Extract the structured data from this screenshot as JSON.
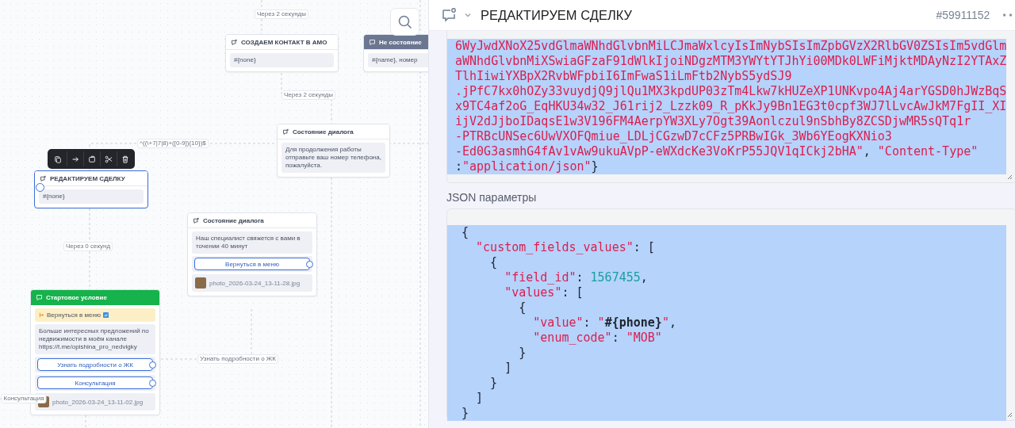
{
  "canvas": {
    "edge_labels": [
      {
        "text": "Через 2 секунды"
      },
      {
        "text": "Через 2 секунды"
      },
      {
        "text": "^((\\+7|7|8)+([0-9]){10})$"
      },
      {
        "text": "Через 0 секунд"
      },
      {
        "text": "Узнать подробности о ЖК"
      },
      {
        "text": "Консультация"
      }
    ],
    "nodes": [
      {
        "kind": "action",
        "title": "СОЗДАЕМ КОНТАКТ В АМО",
        "selected": false,
        "blocks": [
          {
            "kind": "text",
            "text": "#{none}"
          }
        ]
      },
      {
        "kind": "dark",
        "title": "Не состояние",
        "selected": false,
        "blocks": [
          {
            "kind": "text",
            "text": "#{name}, номер"
          }
        ]
      },
      {
        "kind": "action",
        "title": "Состояние диалога",
        "selected": false,
        "blocks": [
          {
            "kind": "text",
            "text": "Для продолжения работы отправьте ваш номер телефона, пожалуйста."
          }
        ]
      },
      {
        "kind": "action",
        "title": "РЕДАКТИРУЕМ СДЕЛКУ",
        "selected": true,
        "blocks": [
          {
            "kind": "text",
            "text": "#{none}"
          }
        ]
      },
      {
        "kind": "action",
        "title": "Состояние диалога",
        "selected": false,
        "blocks": [
          {
            "kind": "text",
            "text": "Наш специалист свяжется с вами в точении 40 минут"
          },
          {
            "kind": "button",
            "text": "Вернуться в меню"
          },
          {
            "kind": "image",
            "text": "photo_2026-03-24_13-11-28.jpg"
          }
        ]
      },
      {
        "kind": "start",
        "title": "Стартовое условие",
        "selected": false,
        "blocks": [
          {
            "kind": "goto",
            "text": "Вернуться в меню"
          },
          {
            "kind": "text",
            "text": "Больше интересных предложений по недвижимости в моём канале https://t.me/opishina_pro_nedvigky"
          },
          {
            "kind": "button",
            "text": "Узнать подробности о ЖК"
          },
          {
            "kind": "button",
            "text": "Консультация"
          },
          {
            "kind": "image",
            "text": "photo_2026-03-24_13-11-02.jpg"
          }
        ]
      }
    ]
  },
  "panel": {
    "title": "РЕДАКТИРУЕМ СДЕЛКУ",
    "id": "#59911152",
    "headers_code": {
      "selected": true,
      "lines": [
        [
          {
            "text": "6WyJwdXNoX25vdGlmaWNhdGlvbnMiLCJmaWxlcyIsImNybSIsImZpbGVzX2RlbGV0ZSIsIm5vdGlm",
            "kind": "string"
          }
        ],
        [
          {
            "text": "aWNhdGlvbnMiXSwiaGFzaF91dWlkIjoiNDgzMTM3YWYtYTJhYi00MDk0LWFiMjktMDAyNzI2YTAxZ",
            "kind": "string"
          }
        ],
        [
          {
            "text": "TlhIiwiYXBpX2RvbWFpbiI6ImFwaS1iLmFtb2NybS5ydSJ9",
            "kind": "string"
          }
        ],
        [
          {
            "text": ".jPfC7kx0hOZy33vuydjQ9jlQu1MX3kpdUP03zTm4Lkw7kHUZeXP1UNKvpo4Aj4arYGSD0hJWzBqS",
            "kind": "string"
          }
        ],
        [
          {
            "text": "x9TC4af2oG_EqHKU34w32_J61rij2_Lzzk09_R_pKkJy9Bn1EG3t0cpf3WJ7lLvcAwJkM7FgII_XI",
            "kind": "string"
          }
        ],
        [
          {
            "text": "ijV2dJjboIDaqsE1w3V196FM4AerpYW3XLy7Ogt39Aonlczul9nSbhBy8ZCSDjwMR5sQTq1r",
            "kind": "string"
          }
        ],
        [
          {
            "text": "-PTRBcUNSec6UwVXOFQmiue_LDLjCGzwD7cCFz5PRBwIGk_3Wb6YEogKXNio3",
            "kind": "string"
          }
        ],
        [
          {
            "text": "-Ed0G3asmhG4fAv1vAw9ukuAVpP-eWXdcKe3VoKrP55JQV1qICkj2bHA\"",
            "kind": "string"
          },
          {
            "text": ", ",
            "kind": "plain"
          },
          {
            "text": "\"Content-Type\"",
            "kind": "string"
          }
        ],
        [
          {
            "text": ":",
            "kind": "plain"
          },
          {
            "text": "\"application/json\"",
            "kind": "string"
          },
          {
            "text": "}",
            "kind": "plain"
          }
        ]
      ]
    },
    "json_label": "JSON параметры",
    "json_code": {
      "selected": true,
      "lines": [
        [
          {
            "text": "{",
            "kind": "plain"
          }
        ],
        [
          {
            "text": "  \"custom_fields_values\"",
            "kind": "string"
          },
          {
            "text": ": [",
            "kind": "plain"
          }
        ],
        [
          {
            "text": "    {",
            "kind": "plain"
          }
        ],
        [
          {
            "text": "      \"field_id\"",
            "kind": "string"
          },
          {
            "text": ": ",
            "kind": "plain"
          },
          {
            "text": "1567455",
            "kind": "number"
          },
          {
            "text": ",",
            "kind": "plain"
          }
        ],
        [
          {
            "text": "      \"values\"",
            "kind": "string"
          },
          {
            "text": ": [",
            "kind": "plain"
          }
        ],
        [
          {
            "text": "        {",
            "kind": "plain"
          }
        ],
        [
          {
            "text": "          \"value\"",
            "kind": "string"
          },
          {
            "text": ": ",
            "kind": "plain"
          },
          {
            "text": "\"",
            "kind": "string"
          },
          {
            "text": "#{phone}",
            "kind": "var"
          },
          {
            "text": "\"",
            "kind": "string"
          },
          {
            "text": ",",
            "kind": "plain"
          }
        ],
        [
          {
            "text": "          \"enum_code\"",
            "kind": "string"
          },
          {
            "text": ": ",
            "kind": "plain"
          },
          {
            "text": "\"MOB\"",
            "kind": "string"
          }
        ],
        [
          {
            "text": "        }",
            "kind": "plain"
          }
        ],
        [
          {
            "text": "      ]",
            "kind": "plain"
          }
        ],
        [
          {
            "text": "    }",
            "kind": "plain"
          }
        ],
        [
          {
            "text": "  ]",
            "kind": "plain"
          }
        ],
        [
          {
            "text": "}",
            "kind": "plain"
          }
        ]
      ]
    }
  }
}
